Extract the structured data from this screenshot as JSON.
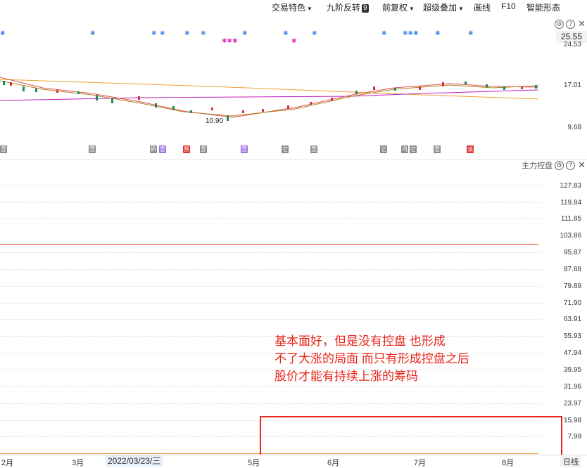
{
  "toolbar": {
    "items": [
      {
        "label": "交易特色",
        "dropdown": true
      },
      {
        "label": "九阶反转",
        "badge": "9"
      },
      {
        "label": "前复权",
        "dropdown": true
      },
      {
        "label": "超级叠加",
        "dropdown": true
      },
      {
        "label": "画线"
      },
      {
        "label": "F10"
      },
      {
        "label": "智能形态"
      }
    ]
  },
  "price_panel": {
    "current_price": "25.55",
    "axis_labels": [
      "24.53",
      "17.01",
      "9.68"
    ],
    "low_label": "10.90",
    "colors": {
      "up": "#e03030",
      "down": "#1a8a5a",
      "ma_orange": "#f0a030",
      "ma_purple": "#c020c0"
    }
  },
  "indicator_panel": {
    "title": "主力控盘",
    "axis_labels": [
      "127.83",
      "119.84",
      "111.85",
      "103.86",
      "95.87",
      "87.88",
      "79.89",
      "71.90",
      "63.91",
      "55.93",
      "47.94",
      "39.95",
      "31.96",
      "23.97",
      "15.98",
      "7.99"
    ],
    "line_color": "#e03030"
  },
  "events": [
    {
      "label": "壹",
      "color": "gray"
    },
    {
      "label": "壹",
      "color": "gray"
    },
    {
      "label": "研",
      "color": "gray"
    },
    {
      "label": "壹",
      "color": "purple"
    },
    {
      "label": "预",
      "color": "red"
    },
    {
      "label": "壹",
      "color": "gray"
    },
    {
      "label": "壹",
      "color": "purple"
    },
    {
      "label": "它",
      "color": "gray"
    },
    {
      "label": "壹",
      "color": "gray"
    },
    {
      "label": "它",
      "color": "gray"
    },
    {
      "label": "讯",
      "color": "gray"
    },
    {
      "label": "它",
      "color": "gray"
    },
    {
      "label": "壹",
      "color": "gray"
    },
    {
      "label": "派",
      "color": "red"
    }
  ],
  "annotation": {
    "lines": [
      "基本面好，但是没有控盘 也形成",
      "不了大涨的局面 而只有形成控盘之后",
      "股价才能有持续上涨的筹码"
    ]
  },
  "time_axis": {
    "months": [
      "2月",
      "3月",
      "5月",
      "6月",
      "7月",
      "8月"
    ],
    "cursor_date": "2022/03/23/三",
    "period": "日线"
  }
}
